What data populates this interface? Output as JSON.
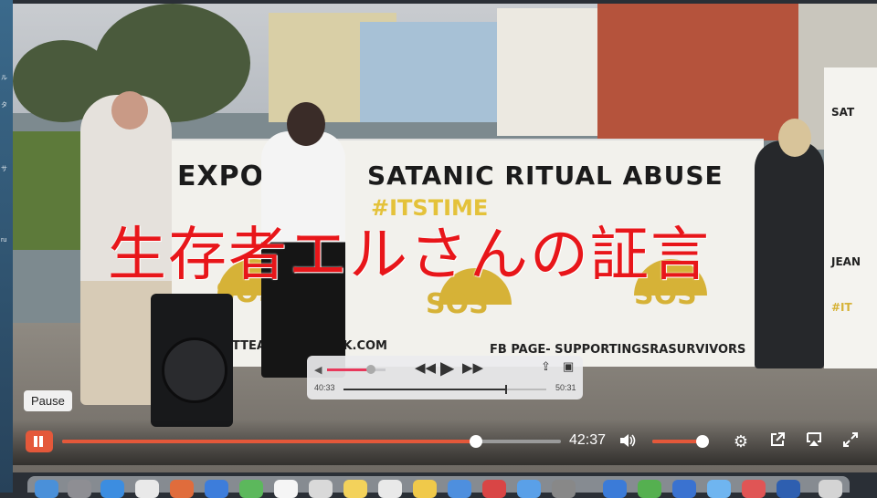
{
  "video": {
    "banner_main": "EXPO",
    "banner_main_rest": "SATANIC RITUAL ABUSE",
    "banner_hashtag": "#ITSTIME",
    "banner_sos": "SOS",
    "banner_email": "TTEARC  OUTLOOK.COM",
    "banner_fb": "FB PAGE- SUPPORTINGSRASURVIVORS",
    "side_banner_lines": [
      "SAT",
      "JEAN",
      "#IT"
    ],
    "caption": "生存者エルさんの証言"
  },
  "mini_player": {
    "elapsed": "40:33",
    "total": "50:31",
    "volume_fraction": 0.75,
    "progress_fraction": 0.8
  },
  "player": {
    "time": "42:37",
    "tooltip": "Pause",
    "progress_fraction": 0.83,
    "volume_fraction": 1.0,
    "icons": [
      "play-pause-icon",
      "volume-icon",
      "settings-gear-icon",
      "popout-icon",
      "airplay-icon",
      "fullscreen-icon"
    ]
  },
  "colors": {
    "accent": "#e4583a",
    "caption": "#e8161a",
    "banner_yellow": "#d6b237"
  }
}
